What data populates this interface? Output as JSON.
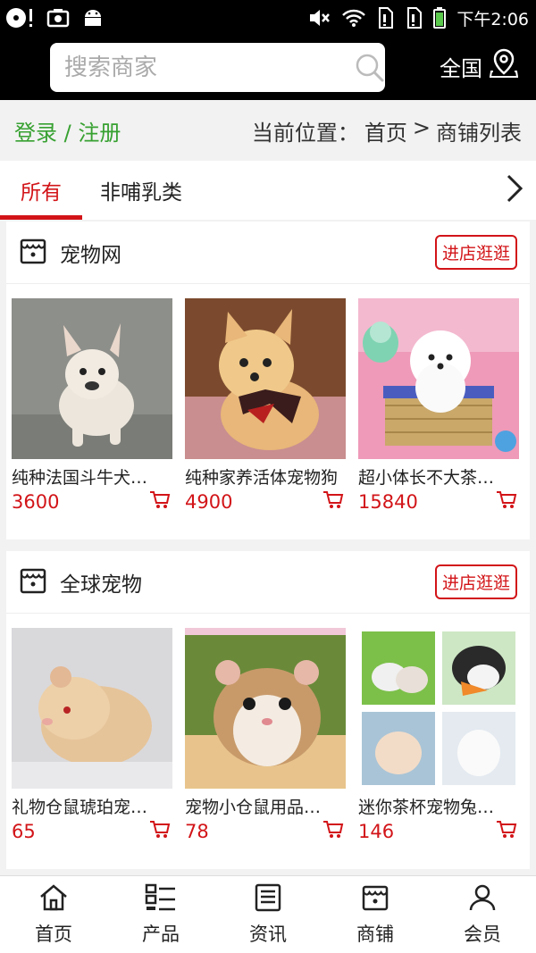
{
  "status_bar": {
    "time": "下午2:06"
  },
  "search": {
    "placeholder": "搜索商家",
    "region_label": "全国"
  },
  "breadcrumb": {
    "login": "登录 / 注册",
    "prefix": "当前位置：",
    "home": "首页",
    "separator": ">",
    "current": "商铺列表"
  },
  "tabs": [
    {
      "label": "所有",
      "active": true
    },
    {
      "label": "非哺乳类",
      "active": false
    }
  ],
  "shops": [
    {
      "name": "宠物网",
      "enter_label": "进店逛逛",
      "products": [
        {
          "name": "纯种法国斗牛犬…",
          "price": "3600"
        },
        {
          "name": "纯种家养活体宠物狗",
          "price": "4900"
        },
        {
          "name": "超小体长不大茶…",
          "price": "15840"
        }
      ]
    },
    {
      "name": "全球宠物",
      "enter_label": "进店逛逛",
      "products": [
        {
          "name": "礼物仓鼠琥珀宠…",
          "price": "65"
        },
        {
          "name": "宠物小仓鼠用品…",
          "price": "78"
        },
        {
          "name": "迷你茶杯宠物兔…",
          "price": "146"
        }
      ]
    }
  ],
  "bottom_nav": [
    {
      "label": "首页",
      "icon": "home-icon"
    },
    {
      "label": "产品",
      "icon": "grid-list-icon"
    },
    {
      "label": "资讯",
      "icon": "news-icon"
    },
    {
      "label": "商铺",
      "icon": "shop-icon"
    },
    {
      "label": "会员",
      "icon": "user-icon"
    }
  ],
  "colors": {
    "accent_red": "#d21418",
    "login_green": "#37a131",
    "header_bg": "#000000"
  }
}
